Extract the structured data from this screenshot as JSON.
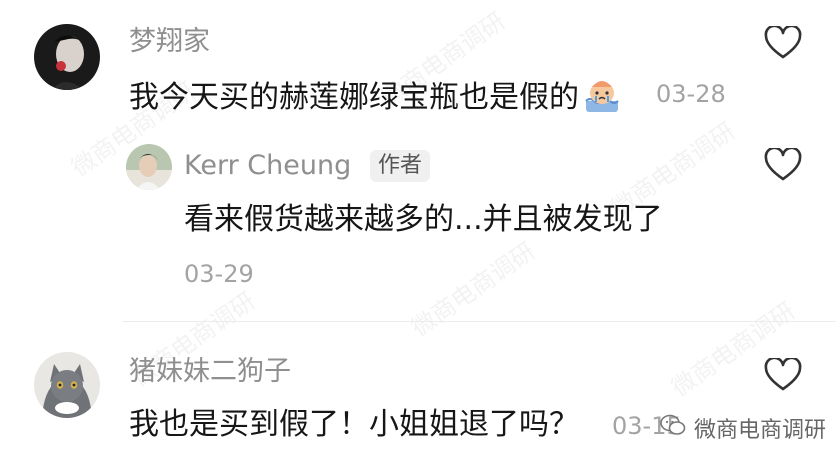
{
  "comments": [
    {
      "author": "梦翔家",
      "text": "我今天买的赫莲娜绿宝瓶也是假的",
      "emoji_icon": "crying-cake-emoji",
      "time": "03-28",
      "like_icon": "heart-outline-icon"
    },
    {
      "author": "Kerr Cheung",
      "badge": "作者",
      "text": "看来假货越来越多的...并且被发现了",
      "time": "03-29",
      "like_icon": "heart-outline-icon"
    },
    {
      "author": "猪妹妹二狗子",
      "text": "我也是买到假了！小姐姐退了吗？",
      "time": "03-15",
      "like_icon": "heart-outline-icon"
    }
  ],
  "watermark": {
    "label": "微商电商调研",
    "icon": "wechat-icon"
  },
  "colors": {
    "author": "#8f8f8f",
    "text": "#161616",
    "time": "#a3a3a3",
    "badge_bg": "#f0f0f0"
  }
}
